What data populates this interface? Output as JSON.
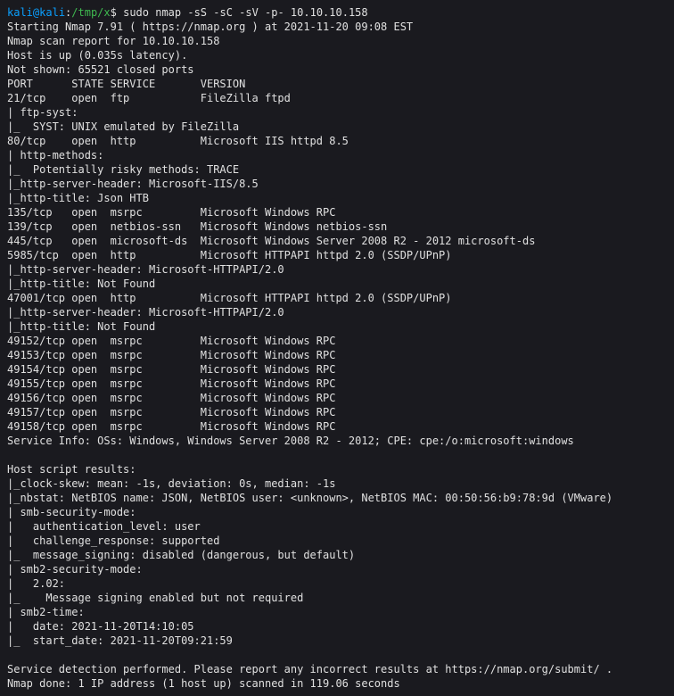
{
  "prompt": {
    "user": "kali",
    "at": "@",
    "host": "kali",
    "colon": ":",
    "path": "/tmp/x",
    "symbol": "$ ",
    "command": "sudo nmap -sS -sC -sV -p- 10.10.10.158"
  },
  "output_lines": [
    "Starting Nmap 7.91 ( https://nmap.org ) at 2021-11-20 09:08 EST",
    "Nmap scan report for 10.10.10.158",
    "Host is up (0.035s latency).",
    "Not shown: 65521 closed ports",
    "PORT      STATE SERVICE       VERSION",
    "21/tcp    open  ftp           FileZilla ftpd",
    "| ftp-syst:",
    "|_  SYST: UNIX emulated by FileZilla",
    "80/tcp    open  http          Microsoft IIS httpd 8.5",
    "| http-methods:",
    "|_  Potentially risky methods: TRACE",
    "|_http-server-header: Microsoft-IIS/8.5",
    "|_http-title: Json HTB",
    "135/tcp   open  msrpc         Microsoft Windows RPC",
    "139/tcp   open  netbios-ssn   Microsoft Windows netbios-ssn",
    "445/tcp   open  microsoft-ds  Microsoft Windows Server 2008 R2 - 2012 microsoft-ds",
    "5985/tcp  open  http          Microsoft HTTPAPI httpd 2.0 (SSDP/UPnP)",
    "|_http-server-header: Microsoft-HTTPAPI/2.0",
    "|_http-title: Not Found",
    "47001/tcp open  http          Microsoft HTTPAPI httpd 2.0 (SSDP/UPnP)",
    "|_http-server-header: Microsoft-HTTPAPI/2.0",
    "|_http-title: Not Found",
    "49152/tcp open  msrpc         Microsoft Windows RPC",
    "49153/tcp open  msrpc         Microsoft Windows RPC",
    "49154/tcp open  msrpc         Microsoft Windows RPC",
    "49155/tcp open  msrpc         Microsoft Windows RPC",
    "49156/tcp open  msrpc         Microsoft Windows RPC",
    "49157/tcp open  msrpc         Microsoft Windows RPC",
    "49158/tcp open  msrpc         Microsoft Windows RPC",
    "Service Info: OSs: Windows, Windows Server 2008 R2 - 2012; CPE: cpe:/o:microsoft:windows",
    "",
    "Host script results:",
    "|_clock-skew: mean: -1s, deviation: 0s, median: -1s",
    "|_nbstat: NetBIOS name: JSON, NetBIOS user: <unknown>, NetBIOS MAC: 00:50:56:b9:78:9d (VMware)",
    "| smb-security-mode:",
    "|   authentication_level: user",
    "|   challenge_response: supported",
    "|_  message_signing: disabled (dangerous, but default)",
    "| smb2-security-mode:",
    "|   2.02:",
    "|_    Message signing enabled but not required",
    "| smb2-time:",
    "|   date: 2021-11-20T14:10:05",
    "|_  start_date: 2021-11-20T09:21:59",
    "",
    "Service detection performed. Please report any incorrect results at https://nmap.org/submit/ .",
    "Nmap done: 1 IP address (1 host up) scanned in 119.06 seconds"
  ]
}
